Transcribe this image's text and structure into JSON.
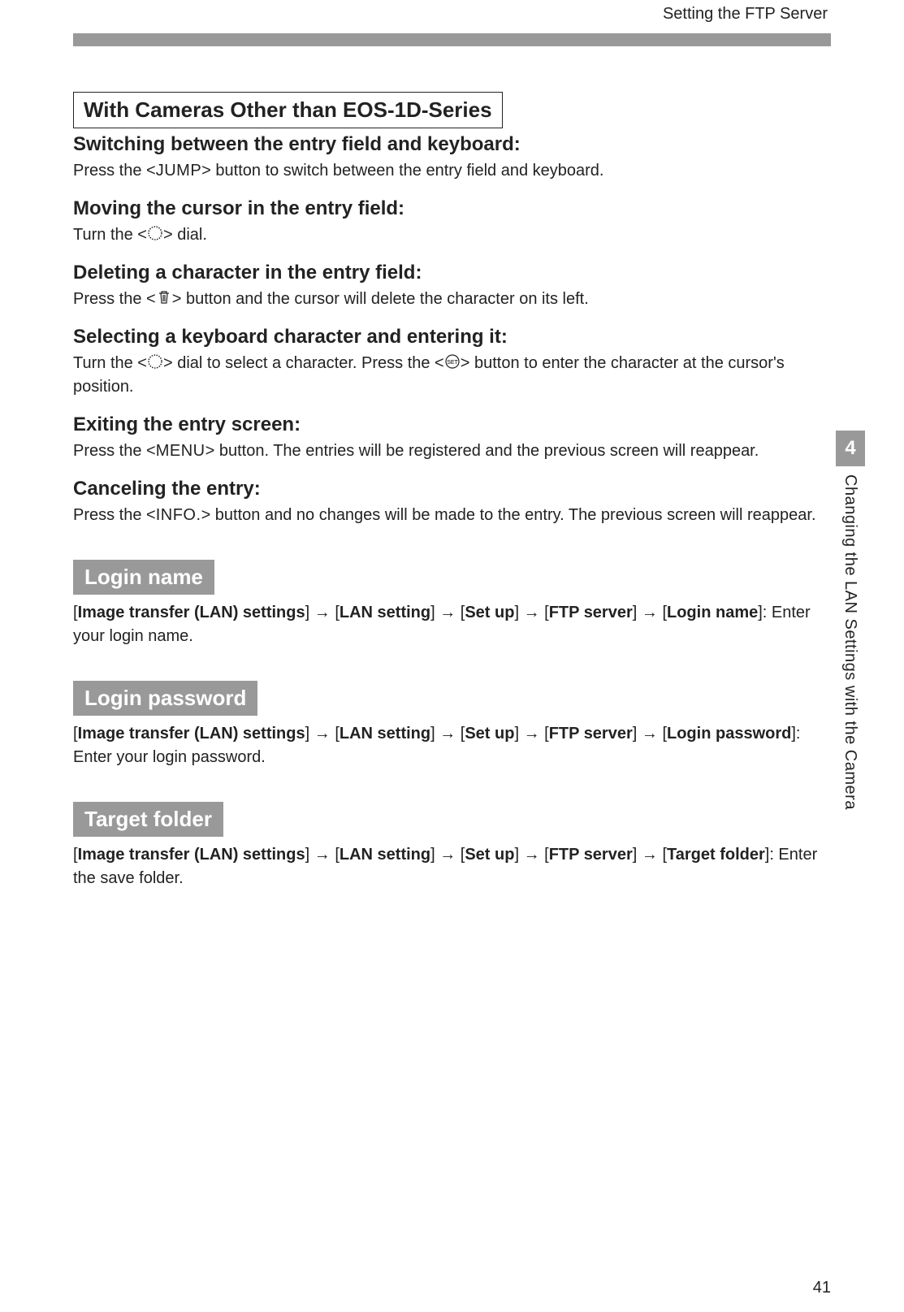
{
  "header": {
    "title": "Setting the FTP Server"
  },
  "box_heading": "With Cameras Other than EOS-1D-Series",
  "s1": {
    "h": "Switching between the entry field and keyboard:",
    "p_pre": "Press the <",
    "p_btn": "JUMP",
    "p_post": "> button to switch between the entry field and keyboard."
  },
  "s2": {
    "h": "Moving the cursor in the entry field:",
    "p_pre": "Turn the <",
    "p_post": "> dial."
  },
  "s3": {
    "h": "Deleting a character in the entry field:",
    "p_pre": "Press the <",
    "p_post": "> button and the cursor will delete the character on its left."
  },
  "s4": {
    "h": "Selecting a keyboard character and entering it:",
    "p1_pre": "Turn the <",
    "p1_mid": "> dial to select a character. Press the <",
    "p1_post": "> button to enter the character at the cursor's position."
  },
  "s5": {
    "h": "Exiting the entry screen:",
    "p_pre": "Press the <",
    "p_btn": "MENU",
    "p_post": "> button. The entries will be registered and the previous screen will reappear."
  },
  "s6": {
    "h": "Canceling the entry:",
    "p_pre": "Press the <",
    "p_btn": "INFO.",
    "p_post": "> button and no changes will be made to the entry. The previous screen will reappear."
  },
  "tag_login_name": "Login name",
  "login_name_path": {
    "a": "Image transfer (LAN) settings",
    "b": "LAN setting",
    "c": "Set up",
    "d": "FTP server",
    "e": "Login name",
    "tail": "]: Enter your login name."
  },
  "tag_login_password": "Login password",
  "login_password_path": {
    "a": "Image transfer (LAN) settings",
    "b": "LAN setting",
    "c": "Set up",
    "d": "FTP server",
    "e": "Login password",
    "tail": "]: Enter your login password."
  },
  "tag_target_folder": "Target folder",
  "target_folder_path": {
    "a": "Image transfer (LAN) settings",
    "b": "LAN setting",
    "c": "Set up",
    "d": "FTP server",
    "e": "Target folder",
    "tail": "]: Enter the save folder."
  },
  "side_tab": {
    "num": "4",
    "label": "Changing the LAN Settings with the Camera"
  },
  "page_number": "41",
  "arrow": " → "
}
